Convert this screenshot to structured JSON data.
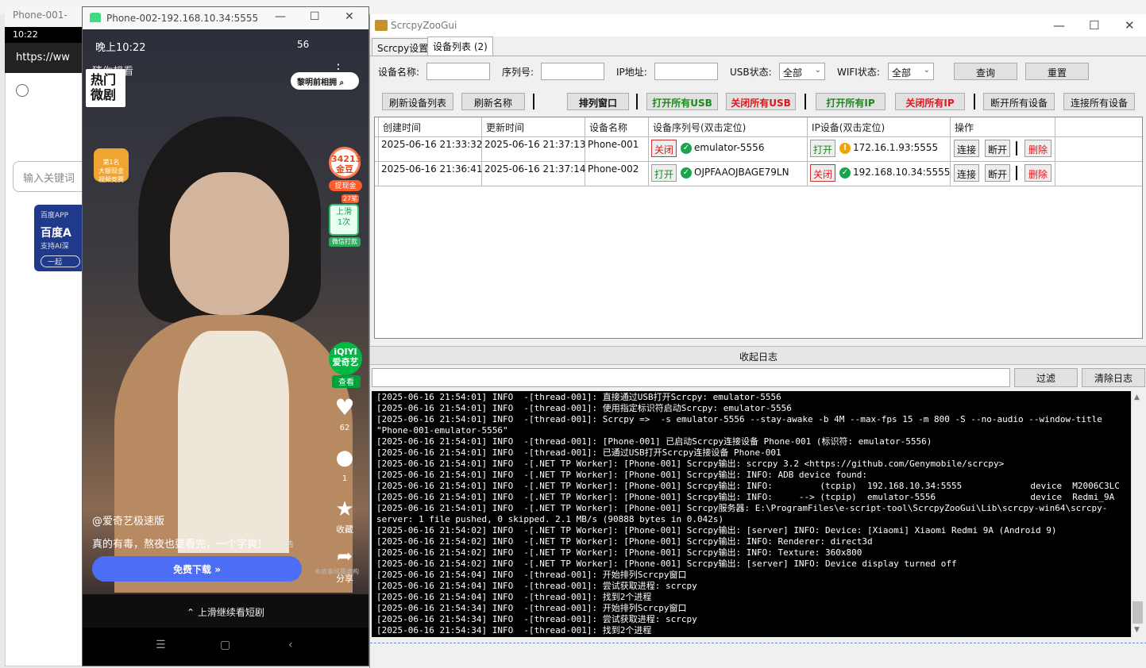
{
  "bg_window": {
    "title": "Phone-001-",
    "status_time": "10:22",
    "url": "https://ww",
    "search_placeholder": "输入关键词",
    "ad_brand": "百度APP",
    "ad_title": "百度A",
    "ad_sub": "支持AI深",
    "ad_btn": "一起"
  },
  "phone2": {
    "title": "Phone-002-192.168.10.34:5555",
    "status_time": "晚上10:22",
    "status_right": "56",
    "search_hint": "猜你想看",
    "hot_label": "热门\n微剧",
    "pill_label": "黎明前相拥",
    "coin_text": "第1名\n大额现金\n视频竞赛",
    "gold_value": "34213",
    "gold_unit": "金豆",
    "gold_tag": "提现金",
    "slide_badge": "27笔",
    "slide_text": "上滑\n1次",
    "slide_tag": "微信打款",
    "iqiyi_text": "iQIYI\n爱奇艺",
    "iqiyi_tag": "查看",
    "like_count": "62",
    "comment_count": "1",
    "fav_label": "收藏",
    "share_label": "分享",
    "author": "@爱奇艺极速版",
    "desc": "真的有毒，熬夜也要看完，一个字爽！",
    "ad_tag": "广告",
    "download": "免费下载 »",
    "fine_print": "本故事纯属虚构",
    "bottom_hint": "上滑继续看短剧"
  },
  "app": {
    "title": "ScrcpyZooGui",
    "tabs": [
      "Scrcpy设置",
      "设备列表 (2)"
    ],
    "filters": {
      "name_label": "设备名称:",
      "serial_label": "序列号:",
      "ip_label": "IP地址:",
      "usb_label": "USB状态:",
      "usb_value": "全部",
      "wifi_label": "WIFI状态:",
      "wifi_value": "全部",
      "query": "查询",
      "reset": "重置"
    },
    "toolbar": {
      "refresh_list": "刷新设备列表",
      "refresh_name": "刷新名称",
      "arrange": "排列窗口",
      "open_usb": "打开所有USB",
      "close_usb": "关闭所有USB",
      "open_ip": "打开所有IP",
      "close_ip": "关闭所有IP",
      "disconnect_all": "断开所有设备",
      "connect_all": "连接所有设备"
    },
    "table": {
      "headers": [
        "创建时间",
        "更新时间",
        "设备名称",
        "设备序列号(双击定位)",
        "IP设备(双击定位)",
        "操作"
      ],
      "rows": [
        {
          "created": "2025-06-16 21:33:32",
          "updated": "2025-06-16 21:37:13",
          "name": "Phone-001",
          "usb_btn": "关闭",
          "serial": "emulator-5556",
          "ip_btn": "打开",
          "ip": "172.16.1.93:5555",
          "connect": "连接",
          "disconnect": "断开",
          "delete": "删除"
        },
        {
          "created": "2025-06-16 21:36:41",
          "updated": "2025-06-16 21:37:14",
          "name": "Phone-002",
          "usb_btn": "打开",
          "serial": "OJPFAAOJBAGE79LN",
          "ip_btn": "关闭",
          "ip": "192.168.10.34:5555",
          "connect": "连接",
          "disconnect": "断开",
          "delete": "删除"
        }
      ]
    },
    "log": {
      "header": "收起日志",
      "filter": "过滤",
      "clear": "清除日志",
      "lines": [
        "[2025-06-16 21:54:01] INFO  -[thread-001]: 直接通过USB打开Scrcpy: emulator-5556",
        "[2025-06-16 21:54:01] INFO  -[thread-001]: 使用指定标识符启动Scrcpy: emulator-5556",
        "[2025-06-16 21:54:01] INFO  -[thread-001]: Scrcpy =>  -s emulator-5556 --stay-awake -b 4M --max-fps 15 -m 800 -S --no-audio --window-title",
        "\"Phone-001-emulator-5556\"",
        "[2025-06-16 21:54:01] INFO  -[thread-001]: [Phone-001] 已启动Scrcpy连接设备 Phone-001 (标识符: emulator-5556)",
        "[2025-06-16 21:54:01] INFO  -[thread-001]: 已通过USB打开Scrcpy连接设备 Phone-001",
        "[2025-06-16 21:54:01] INFO  -[.NET TP Worker]: [Phone-001] Scrcpy输出: scrcpy 3.2 <https://github.com/Genymobile/scrcpy>",
        "[2025-06-16 21:54:01] INFO  -[.NET TP Worker]: [Phone-001] Scrcpy输出: INFO: ADB device found:",
        "[2025-06-16 21:54:01] INFO  -[.NET TP Worker]: [Phone-001] Scrcpy输出: INFO:         (tcpip)  192.168.10.34:5555             device  M2006C3LC",
        "[2025-06-16 21:54:01] INFO  -[.NET TP Worker]: [Phone-001] Scrcpy输出: INFO:     --> (tcpip)  emulator-5556                  device  Redmi_9A",
        "[2025-06-16 21:54:01] INFO  -[.NET TP Worker]: [Phone-001] Scrcpy服务器: E:\\ProgramFiles\\e-script-tool\\ScrcpyZooGui\\Lib\\scrcpy-win64\\scrcpy-",
        "server: 1 file pushed, 0 skipped. 2.1 MB/s (90888 bytes in 0.042s)",
        "[2025-06-16 21:54:02] INFO  -[.NET TP Worker]: [Phone-001] Scrcpy输出: [server] INFO: Device: [Xiaomi] Xiaomi Redmi 9A (Android 9)",
        "[2025-06-16 21:54:02] INFO  -[.NET TP Worker]: [Phone-001] Scrcpy输出: INFO: Renderer: direct3d",
        "[2025-06-16 21:54:02] INFO  -[.NET TP Worker]: [Phone-001] Scrcpy输出: INFO: Texture: 360x800",
        "[2025-06-16 21:54:02] INFO  -[.NET TP Worker]: [Phone-001] Scrcpy输出: [server] INFO: Device display turned off",
        "[2025-06-16 21:54:04] INFO  -[thread-001]: 开始排列Scrcpy窗口",
        "[2025-06-16 21:54:04] INFO  -[thread-001]: 尝试获取进程: scrcpy",
        "[2025-06-16 21:54:04] INFO  -[thread-001]: 找到2个进程",
        "[2025-06-16 21:54:34] INFO  -[thread-001]: 开始排列Scrcpy窗口",
        "[2025-06-16 21:54:34] INFO  -[thread-001]: 尝试获取进程: scrcpy",
        "[2025-06-16 21:54:34] INFO  -[thread-001]: 找到2个进程"
      ]
    }
  }
}
